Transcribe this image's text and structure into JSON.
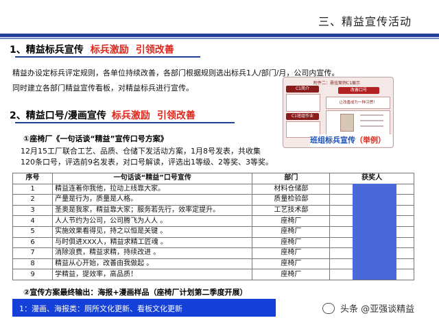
{
  "header": {
    "title": "三、精益宣传活动"
  },
  "section1": {
    "heading": "1、精益标兵宣传",
    "tag1": "标兵激励",
    "tag2": "引领改善",
    "para1": "精益办设定标兵评定规则，各单位持续改善，各部门根据规则选出标兵1人/部门/月，公司内宣传。",
    "para2": "同时建立各部门精益宣传看板，对精益标兵进行宣传。"
  },
  "poster": {
    "header": "附件二：悬挂案例C1展示",
    "box1": "C1简介",
    "box2": "改善口号",
    "box3": "C1班组作业",
    "slogan": "让改善成为一种习惯！",
    "caption": "班组标兵宣传",
    "caption_paren": "（举例）"
  },
  "section2": {
    "heading": "2、精益口号/漫画宣传",
    "tag1": "标兵激励",
    "tag2": "引领改善",
    "sub1": "①座椅厂《一句话谈“精益”宣传口号方案》",
    "desc1": "12月15工厂联合工艺、品质、仓储下发活动方案，1月8号发表，共收集",
    "desc2": "120条口号，评选前9名发表，对口号解读，评选出1等级、2等奖、3等奖。",
    "sub2": "②宣传方案最终输出：海报+漫画样品（座椅厂计划第二季度开展）"
  },
  "table": {
    "headers": [
      "序号",
      "一句话谈“精益”口号宣传",
      "部门",
      "获奖人"
    ],
    "rows": [
      {
        "no": "1",
        "slogan": "精益连着你我他，拉动上线靠大家。",
        "dept": "材料仓储部"
      },
      {
        "no": "2",
        "slogan": "产量是行为，质量是人格。",
        "dept": "质量检验部"
      },
      {
        "no": "3",
        "slogan": "圣奥是我家，精益靠大家；服务若先行，效率定提升。",
        "dept": "工艺技术部"
      },
      {
        "no": "4",
        "slogan": "人人节约为公司，公司腾飞为人人 。",
        "dept": "座椅厂"
      },
      {
        "no": "5",
        "slogan": "实施效果看得见，持之以恒是关键 。",
        "dept": "座椅厂"
      },
      {
        "no": "6",
        "slogan": "与时俱进XXX人，精益求精工匠魂 。",
        "dept": "座椅厂"
      },
      {
        "no": "7",
        "slogan": "消除浪费，精益求精，持续改进 。",
        "dept": "座椅厂"
      },
      {
        "no": "8",
        "slogan": "精益从心开始，改善由我做起 。",
        "dept": "座椅厂"
      },
      {
        "no": "9",
        "slogan": "学精益，提效率，高品质！",
        "dept": "座椅厂"
      }
    ]
  },
  "bottom": {
    "text": "1：漫画、海报类：厕所文化更新、看板文化更新"
  },
  "watermark": {
    "text": "头条 @亚强谈精益"
  },
  "colors": {
    "accent_red": "#e0261b",
    "navy": "#1f3f96",
    "blue_bar": "#1440d8"
  }
}
